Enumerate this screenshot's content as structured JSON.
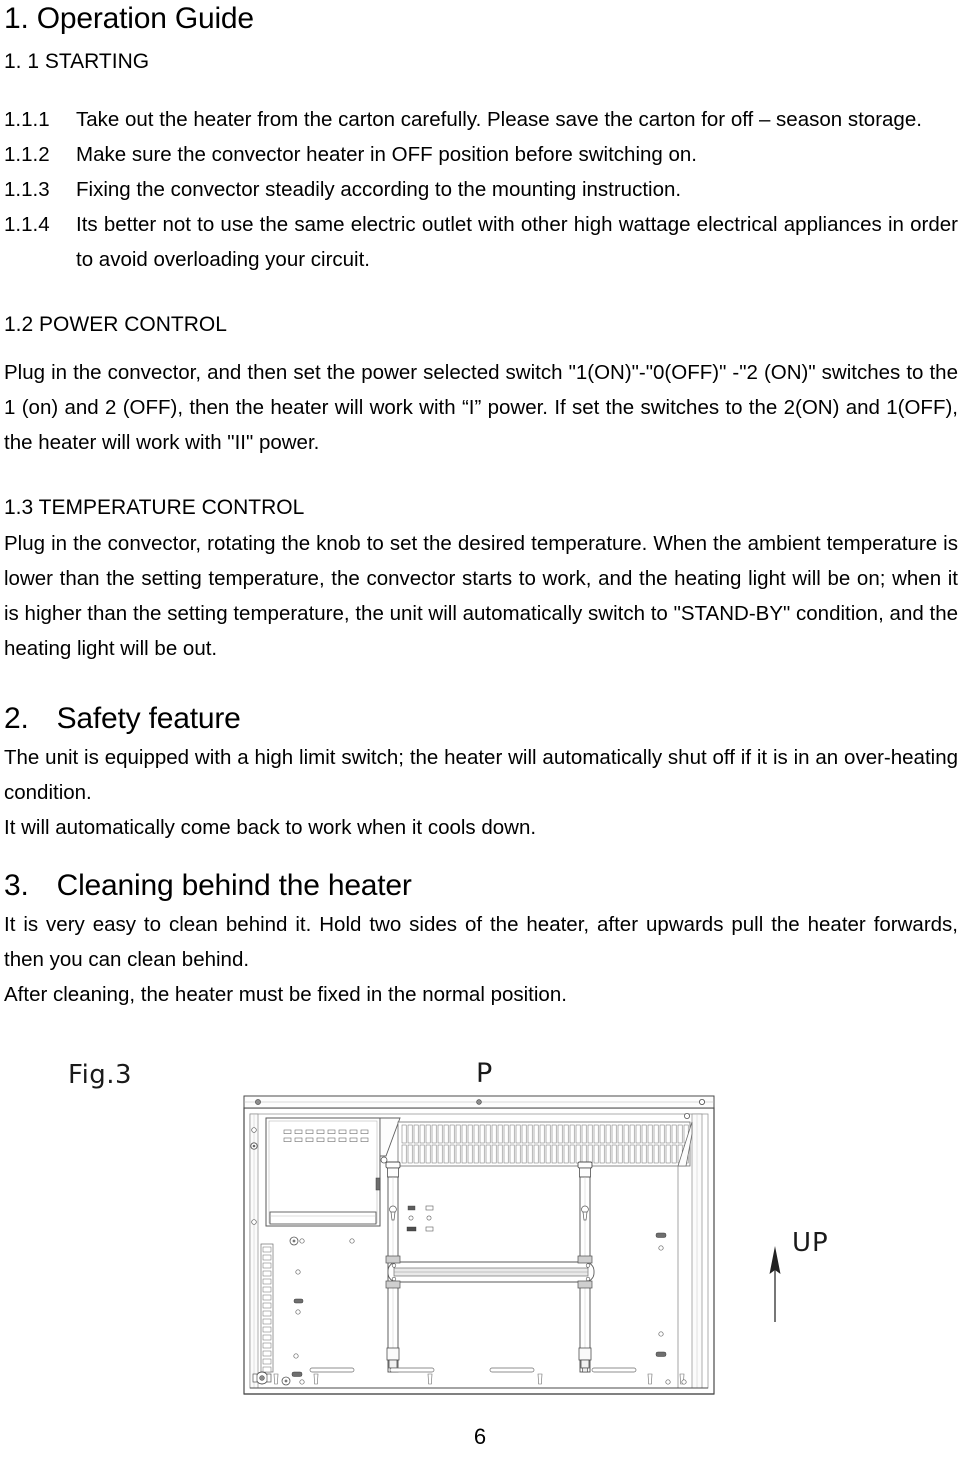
{
  "document": {
    "page_number": "6"
  },
  "sections": {
    "title": "1. Operation Guide",
    "starting": {
      "heading": "1. 1 STARTING",
      "items": [
        {
          "num": "1.1.1",
          "text": "Take out the heater from the carton carefully. Please save the carton for off – season storage."
        },
        {
          "num": "1.1.2",
          "text": "Make sure the convector heater in OFF position before switching on."
        },
        {
          "num": "1.1.3",
          "text": "Fixing the convector steadily according to the mounting instruction."
        },
        {
          "num": "1.1.4",
          "text": "Its better not to use the same electric outlet with other high wattage electrical appliances in order to avoid overloading your circuit."
        }
      ]
    },
    "power_control": {
      "heading": "1.2 POWER CONTROL",
      "body": "Plug in the convector, and then set the power selected switch \"1(ON)\"-\"0(OFF)\" -\"2 (ON)\" switches to the 1 (on) and 2 (OFF), then the heater will work with “I” power. If set the switches to the 2(ON) and 1(OFF), the heater will work with \"II\" power."
    },
    "temperature_control": {
      "heading": "1.3   TEMPERATURE CONTROL",
      "body": "Plug in the convector, rotating the knob to set the desired temperature. When the ambient temperature is lower than the setting temperature, the convector starts to work, and the heating light will be on; when it is higher than the setting temperature, the unit will automatically switch to \"STAND-BY\" condition, and the heating light will be out."
    },
    "safety_feature": {
      "heading_num": "2.",
      "heading": "Safety feature",
      "body1": "The unit is equipped with a high limit switch; the heater will automatically shut off if it is in an over-heating condition.",
      "body2": "It will automatically come back to work when it cools down."
    },
    "cleaning": {
      "heading_num": "3.",
      "heading": "Cleaning behind the heater",
      "body1": "It is very easy to clean behind it. Hold two sides of the heater, after upwards pull the heater forwards, then you can clean behind.",
      "body2": "After cleaning, the heater must be fixed in the normal position."
    }
  },
  "figure": {
    "caption": "Fig.3",
    "pointer_label": "P",
    "direction_label": "UP",
    "direction_icon": "up-arrow-icon"
  }
}
